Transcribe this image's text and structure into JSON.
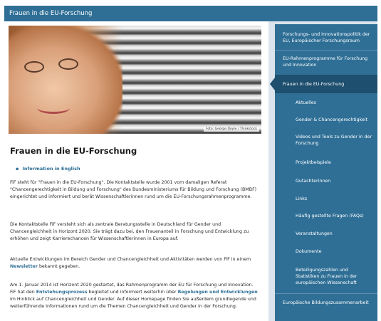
{
  "header": {
    "title": "Frauen in die EU-Forschung"
  },
  "hero": {
    "caption": "Foto: George Doyle / Thinkstock"
  },
  "main": {
    "title": "Frauen in die EU-Forschung",
    "language_link": "Information in English",
    "p1": "FiF steht für \"Frauen in die EU-Forschung\". Die Kontaktstelle wurde 2001 vom damaligen Referat \"Chancengerechtigkeit in Bildung und Forschung\" des Bundesministeriums für Bildung und Forschung (BMBF) eingerichtet und informiert und berät Wissenschaftlerinnen rund um die EU-Forschungsrahmenprogramme.",
    "p2": "Die Kontaktstelle FiF versteht sich als zentrale Beratungsstelle in Deutschland für Gender und Chancengleichheit in Horizont 2020. Sie trägt dazu bei, den Frauenanteil in Forschung und Entwicklung zu erhöhen und zeigt Karrierechancen für Wissenschaftlerinnen in Europa auf.",
    "p3_a": "Aktuelle Entwicklungen im Bereich Gender und Chancengleichheit und Aktivitäten werden von FiF in einem ",
    "p3_link": "Newsletter",
    "p3_b": " bekannt gegeben.",
    "p4_a": "Am 1. Januar 2014 ist Horizont 2020 gestartet, das Rahmenprogramm der EU für Forschung und Innovation. FiF hat den ",
    "p4_link1": "Entstehungsprozess",
    "p4_b": " begleitet und informiert weiterhin über ",
    "p4_link2": "Regelungen und Entwicklungen",
    "p4_c": " im Hinblick auf Chancengleichheit und Gender. Auf dieser Homepage finden Sie außerdem grundlegende und weiterführende Informationen rund um die Themen Chancengleichheit und Gender in der Forschung."
  },
  "sidebar": {
    "items": [
      {
        "label": "Forschungs- und Innovationspolitik der EU, Europäischer Forschungsraum"
      },
      {
        "label": "EU-Rahmenprogramme für Forschung und Innovation"
      },
      {
        "label": "Frauen in die EU-Forschung"
      },
      {
        "label": "Aktuelles"
      },
      {
        "label": "Gender & Chancengerechtigkeit"
      },
      {
        "label": "Videos und Tools zu Gender in der Forschung"
      },
      {
        "label": "Projektbeispiele"
      },
      {
        "label": "Gutachterinnen"
      },
      {
        "label": "Links"
      },
      {
        "label": "Häufig gestellte Fragen (FAQs)"
      },
      {
        "label": "Veranstaltungen"
      },
      {
        "label": "Dokumente"
      },
      {
        "label": "Beteiligungszahlen und Statistiken zu Frauen in der europäischen Wissenschaft"
      },
      {
        "label": "Europäische Bildungszusammenarbeit"
      }
    ]
  }
}
